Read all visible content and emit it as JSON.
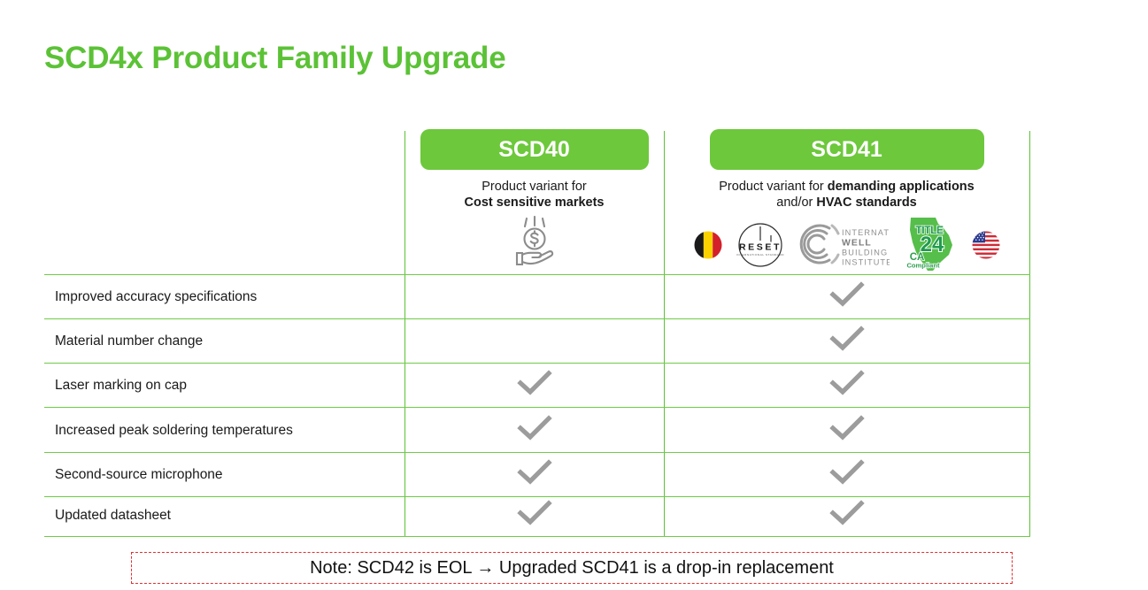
{
  "slide": {
    "title": "SCD4x Product Family Upgrade",
    "title_color": "#5BC236"
  },
  "colors": {
    "brand_green": "#6DC83C",
    "rule_green": "#6FCB48",
    "check_gray": "#9C9C9C",
    "note_red": "#E03030"
  },
  "table": {
    "columns": [
      {
        "id": "feature",
        "header": ""
      },
      {
        "id": "scd40",
        "header": "SCD40",
        "subtitle_line1": "Product variant for",
        "subtitle_line2": "Cost sensitive markets",
        "icon": "hand-holding-coin-icon"
      },
      {
        "id": "scd41",
        "header": "SCD41",
        "subtitle_line1_prefix": "Product variant for ",
        "subtitle_line1_bold": "demanding applications",
        "subtitle_line2_prefix": "and/or ",
        "subtitle_line2_bold": "HVAC standards",
        "badges": [
          {
            "name": "belgium-flag-badge",
            "label": "Belgium"
          },
          {
            "name": "reset-standard-badge",
            "label": "RESET",
            "sub": "INTERNATIONAL STANDARD"
          },
          {
            "name": "well-building-institute-badge",
            "line1": "INTERNATIONAL",
            "line2": "WELL",
            "line3": "BUILDING",
            "line4": "INSTITUTE™"
          },
          {
            "name": "title-24-ca-compliant-badge",
            "line1": "TITLE",
            "line2": "24",
            "line3": "CA",
            "line4": "Compliant"
          },
          {
            "name": "usa-flag-badge",
            "label": "United States"
          }
        ]
      }
    ],
    "rows": [
      {
        "label": "Improved accuracy specifications",
        "scd40": false,
        "scd41": true
      },
      {
        "label": "Material number change",
        "scd40": false,
        "scd41": true
      },
      {
        "label": "Laser marking on cap",
        "scd40": true,
        "scd41": true
      },
      {
        "label": "Increased peak soldering temperatures",
        "scd40": true,
        "scd41": true
      },
      {
        "label": "Second-source microphone",
        "scd40": true,
        "scd41": true
      },
      {
        "label": "Updated datasheet",
        "scd40": true,
        "scd41": true
      }
    ]
  },
  "footer": {
    "note": "Note: SCD42 is EOL → Upgraded SCD41 is a drop-in replacement"
  }
}
